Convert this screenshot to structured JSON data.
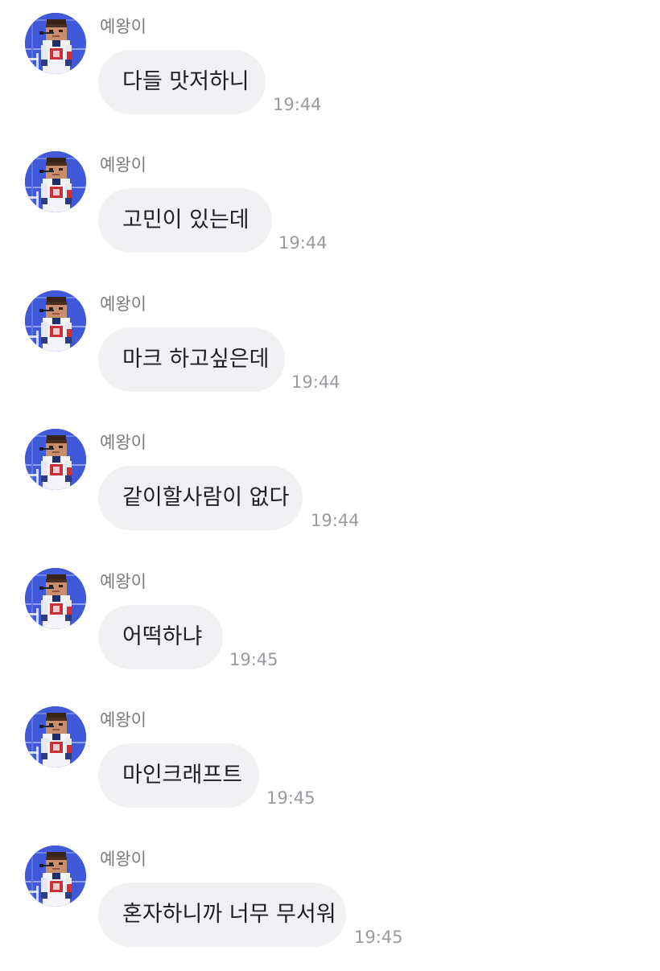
{
  "chat": {
    "messages": [
      {
        "sender": "예왕이",
        "text": "다들 맛저하니",
        "time": "19:44"
      },
      {
        "sender": "예왕이",
        "text": "고민이 있는데",
        "time": "19:44"
      },
      {
        "sender": "예왕이",
        "text": "마크 하고싶은데",
        "time": "19:44"
      },
      {
        "sender": "예왕이",
        "text": "같이할사람이 없다",
        "time": "19:44"
      },
      {
        "sender": "예왕이",
        "text": "어떡하냐",
        "time": "19:45"
      },
      {
        "sender": "예왕이",
        "text": "마인크래프트",
        "time": "19:45"
      },
      {
        "sender": "예왕이",
        "text": "혼자하니까 너무 무서워",
        "time": "19:45"
      }
    ]
  },
  "colors": {
    "bubble_background": "#f1f1f4",
    "message_text": "#1f1f22",
    "sender_text": "#7b7b80",
    "timestamp_text": "#9a9aa0",
    "avatar_background": "#3f59d8"
  },
  "icons": {
    "avatar": "profile-avatar-icon"
  }
}
